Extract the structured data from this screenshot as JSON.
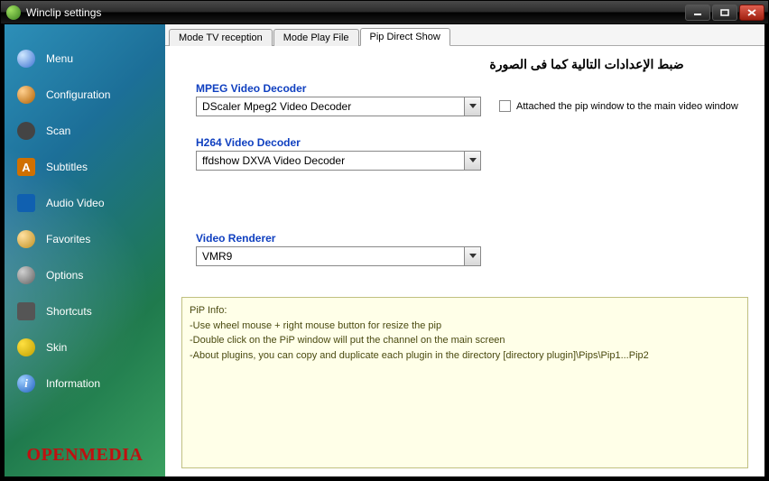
{
  "window": {
    "title": "Winclip settings"
  },
  "sidebar": {
    "items": [
      {
        "label": "Menu",
        "icon": "magnifier-icon",
        "bg": "radial-gradient(circle at 30% 30%,#cfe8ff,#3a70d0)"
      },
      {
        "label": "Configuration",
        "icon": "tools-icon",
        "bg": "radial-gradient(circle at 30% 30%,#ffd090,#b06000)"
      },
      {
        "label": "Scan",
        "icon": "camera-icon",
        "bg": "#444"
      },
      {
        "label": "Subtitles",
        "icon": "subtitles-icon",
        "bg": "#d07000"
      },
      {
        "label": "Audio Video",
        "icon": "screen-icon",
        "bg": "#1060b0"
      },
      {
        "label": "Favorites",
        "icon": "person-icon",
        "bg": "radial-gradient(circle at 30% 30%,#ffe0a0,#c09020)"
      },
      {
        "label": "Options",
        "icon": "gear-icon",
        "bg": "radial-gradient(circle at 30% 30%,#d0d0d0,#606060)"
      },
      {
        "label": "Shortcuts",
        "icon": "keyboard-icon",
        "bg": "#555"
      },
      {
        "label": "Skin",
        "icon": "face-icon",
        "bg": "radial-gradient(circle at 30% 30%,#ffe040,#c0a000)"
      },
      {
        "label": "Information",
        "icon": "info-icon",
        "bg": "radial-gradient(circle at 30% 30%,#a0d0ff,#2060c0)"
      }
    ],
    "brand": "OPENMEDIA"
  },
  "tabs": [
    {
      "label": "Mode TV reception",
      "active": false
    },
    {
      "label": "Mode Play File",
      "active": false
    },
    {
      "label": "Pip Direct Show",
      "active": true
    }
  ],
  "arabic_heading": "ضبط الإعدادات التالية كما فى الصورة",
  "fields": {
    "mpeg_label": "MPEG Video Decoder",
    "mpeg_value": "DScaler Mpeg2 Video Decoder",
    "h264_label": "H264 Video Decoder",
    "h264_value": "ffdshow DXVA Video Decoder",
    "renderer_label": "Video Renderer",
    "renderer_value": "VMR9",
    "attach_label": "Attached the pip window to the main video window"
  },
  "info": {
    "heading": "PiP Info:",
    "line1": "-Use wheel mouse + right mouse button for resize the pip",
    "line2": "-Double click on the PiP window will put the channel on the main screen",
    "line3": "-About plugins, you can copy and duplicate each plugin in the directory [directory plugin]\\Pips\\Pip1...Pip2"
  }
}
